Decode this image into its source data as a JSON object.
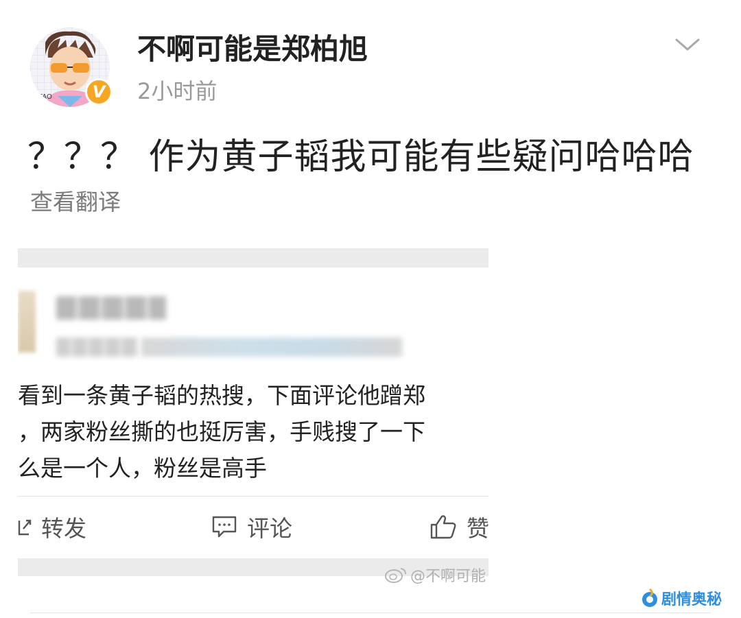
{
  "post": {
    "username": "不啊可能是郑柏旭",
    "timestamp": "2小时前",
    "text": "？？？ 作为黄子韬我可能有些疑问哈哈哈",
    "translate_label": "查看翻译",
    "verified_badge": "V"
  },
  "embedded_screenshot": {
    "lines": [
      "看到一条黄子韬的热搜，下面评论他蹭郑",
      "，两家粉丝撕的也挺厉害，手贱搜了一下",
      "么是一个人，粉丝是高手"
    ],
    "actions": {
      "repost_label": "转发",
      "comment_label": "评论",
      "like_label": "赞"
    },
    "watermark": "@不啊可能"
  },
  "brand": {
    "label": "剧情奥秘",
    "color": "#2f8fdc"
  },
  "colors": {
    "badge": "#f5a623",
    "muted_text": "#9a9a9a"
  }
}
